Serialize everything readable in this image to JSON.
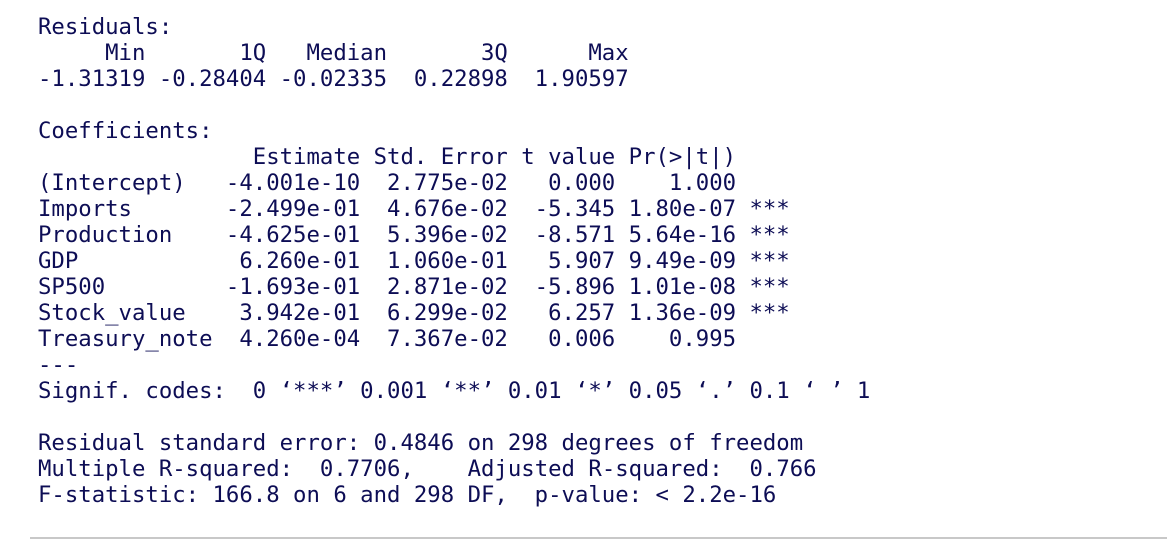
{
  "residuals": {
    "title": "Residuals:",
    "header": "     Min       1Q   Median       3Q      Max ",
    "values": "-1.31319 -0.28404 -0.02335  0.22898  1.90597 "
  },
  "coefficients": {
    "title": "Coefficients:",
    "header": "                Estimate Std. Error t value Pr(>|t|)    ",
    "rows": [
      "(Intercept)   -4.001e-10  2.775e-02   0.000    1.000    ",
      "Imports       -2.499e-01  4.676e-02  -5.345 1.80e-07 ***",
      "Production    -4.625e-01  5.396e-02  -8.571 5.64e-16 ***",
      "GDP            6.260e-01  1.060e-01   5.907 9.49e-09 ***",
      "SP500         -1.693e-01  2.871e-02  -5.896 1.01e-08 ***",
      "Stock_value    3.942e-01  6.299e-02   6.257 1.36e-09 ***",
      "Treasury_note  4.260e-04  7.367e-02   0.006    0.995    "
    ],
    "separator": "---",
    "signif": "Signif. codes:  0 ‘***’ 0.001 ‘**’ 0.01 ‘*’ 0.05 ‘.’ 0.1 ‘ ’ 1"
  },
  "summary": {
    "rse": "Residual standard error: 0.4846 on 298 degrees of freedom",
    "rsquared": "Multiple R-squared:  0.7706,\tAdjusted R-squared:  0.766 ",
    "fstat": "F-statistic: 166.8 on 6 and 298 DF,  p-value: < 2.2e-16"
  },
  "colors": {
    "text": "#0d0d55",
    "background": "#ffffff",
    "rule": "#c8c8c8"
  }
}
